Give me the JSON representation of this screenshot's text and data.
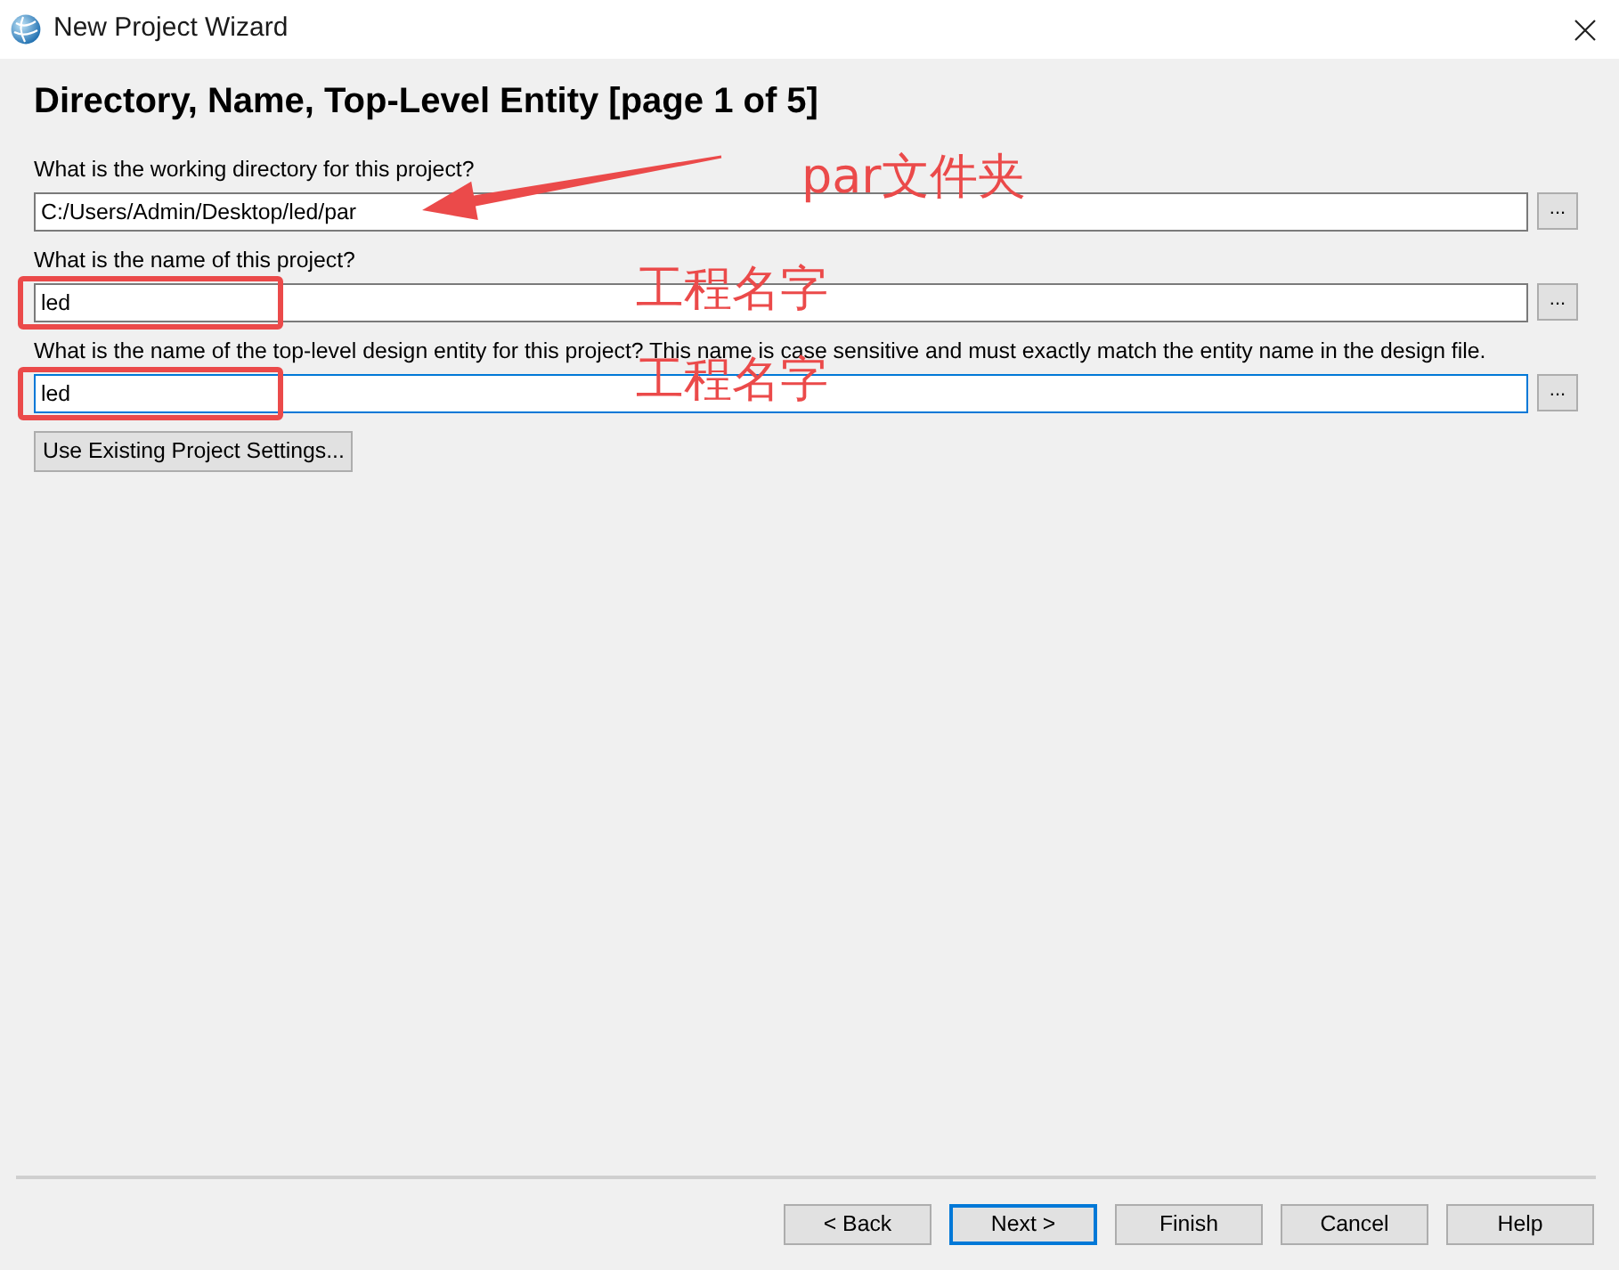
{
  "window": {
    "title": "New Project Wizard"
  },
  "heading": "Directory, Name, Top-Level Entity [page 1 of 5]",
  "fields": [
    {
      "label": "What is the working directory for this project?",
      "value": "C:/Users/Admin/Desktop/led/par",
      "focused": false,
      "browse": "...",
      "annotation": {
        "kind": "arrow",
        "text": "par文件夹"
      }
    },
    {
      "label": "What is the name of this project?",
      "value": "led",
      "focused": false,
      "browse": "...",
      "annotation": {
        "kind": "box",
        "text": "工程名字"
      }
    },
    {
      "label": "What is the name of the top-level design entity for this project? This name is case sensitive and must exactly match the entity name in the design file.",
      "value": "led",
      "focused": true,
      "browse": "...",
      "annotation": {
        "kind": "box",
        "text": "工程名字"
      }
    }
  ],
  "settings_button": "Use Existing Project Settings...",
  "buttons": [
    {
      "label": "< Back",
      "default": false
    },
    {
      "label": "Next >",
      "default": true
    },
    {
      "label": "Finish",
      "default": false
    },
    {
      "label": "Cancel",
      "default": false
    },
    {
      "label": "Help",
      "default": false
    }
  ]
}
